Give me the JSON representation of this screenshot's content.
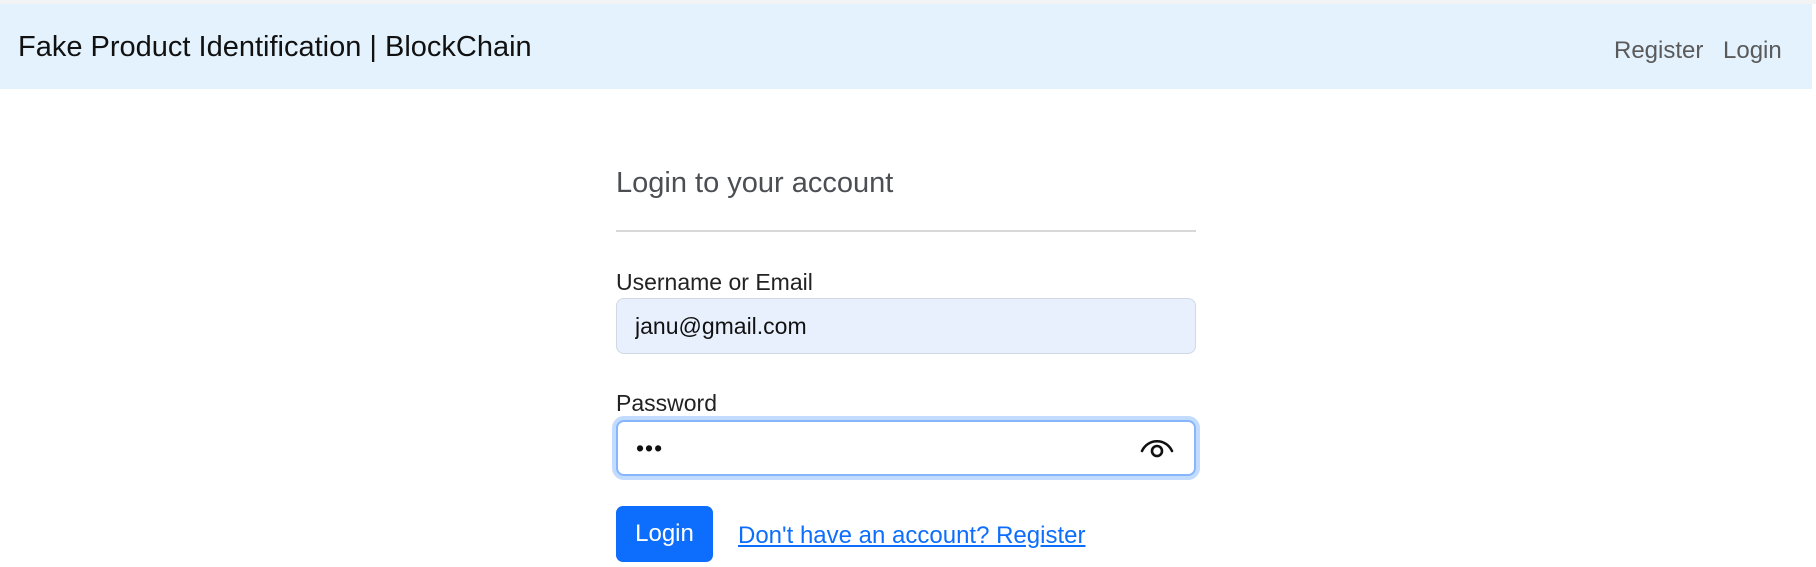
{
  "navbar": {
    "brand": "Fake Product Identification | BlockChain",
    "links": [
      {
        "label": "Register"
      },
      {
        "label": "Login"
      }
    ]
  },
  "form": {
    "heading": "Login to your account",
    "username_label": "Username or Email",
    "username_value": "janu@gmail.com",
    "password_label": "Password",
    "password_value": "abc",
    "password_toggle_icon": "eye-icon",
    "submit_label": "Login",
    "register_link": "Don't have an account? Register"
  },
  "colors": {
    "navbar_bg": "#e3f2fd",
    "primary": "#0d6efd",
    "autofill_bg": "#e8f0fe",
    "focus_border": "#86b7fe"
  }
}
